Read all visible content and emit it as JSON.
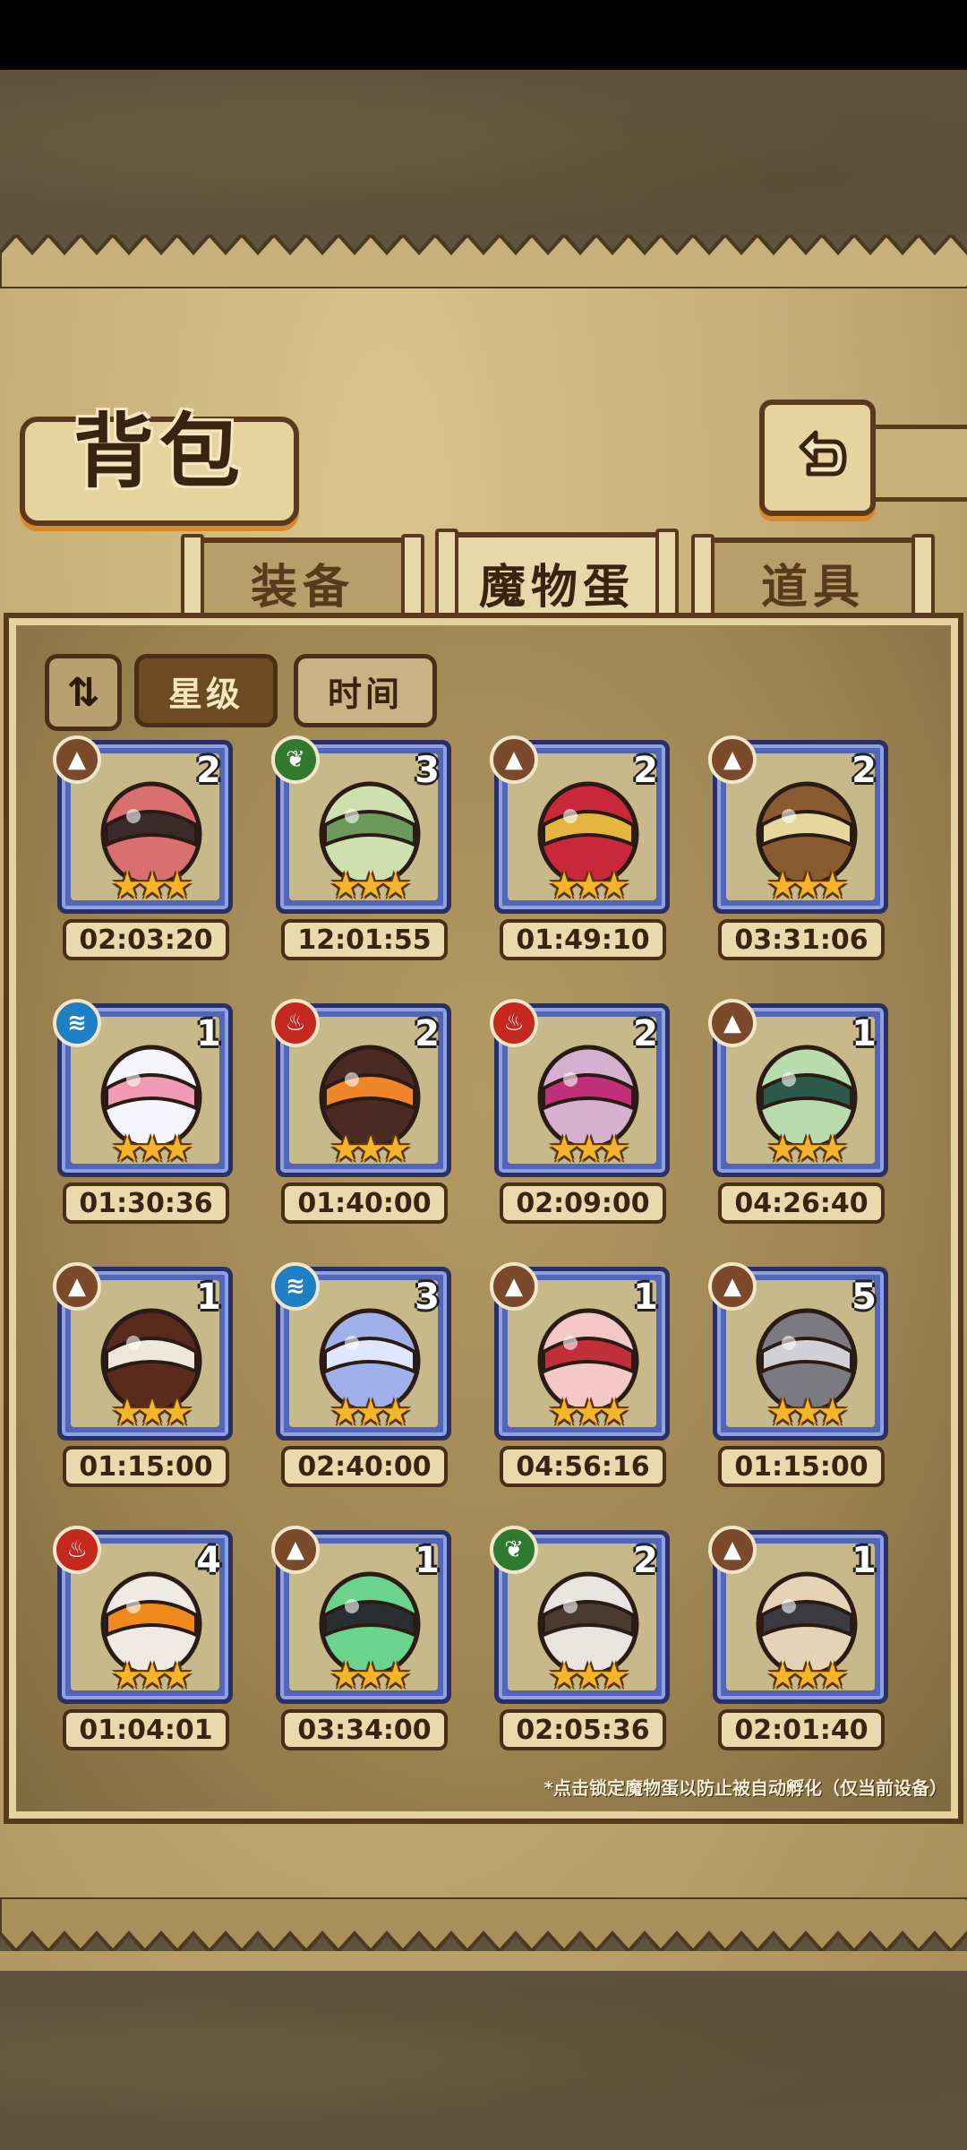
{
  "screen": {
    "title": "背包",
    "back_icon": "back-arrow-icon"
  },
  "tabs": [
    {
      "label": "装备",
      "active": false
    },
    {
      "label": "魔物蛋",
      "active": true
    },
    {
      "label": "道具",
      "active": false
    }
  ],
  "sort": {
    "toggle_icon": "sort-order-icon",
    "toggle_label": "⇅",
    "by_star_label": "星级",
    "by_time_label": "时间",
    "selected": "星级"
  },
  "elements_legend": {
    "earth": "#7a4a2a",
    "wood": "#2f7a2f",
    "water": "#1f7fc4",
    "fire": "#c4281f"
  },
  "eggs": [
    {
      "element": "earth",
      "count": "2",
      "stars": "★★★",
      "timer": "02:03:20",
      "art": "pink-cat-egg"
    },
    {
      "element": "wood",
      "count": "3",
      "stars": "★★★",
      "timer": "12:01:55",
      "art": "green-leaf-egg"
    },
    {
      "element": "earth",
      "count": "2",
      "stars": "★★★",
      "timer": "01:49:10",
      "art": "red-helmet-egg"
    },
    {
      "element": "earth",
      "count": "2",
      "stars": "★★★",
      "timer": "03:31:06",
      "art": "bear-fruit-egg"
    },
    {
      "element": "water",
      "count": "1",
      "stars": "★★★",
      "timer": "01:30:36",
      "art": "white-ribbon-egg"
    },
    {
      "element": "fire",
      "count": "2",
      "stars": "★★★",
      "timer": "01:40:00",
      "art": "flame-spike-egg"
    },
    {
      "element": "fire",
      "count": "2",
      "stars": "★★★",
      "timer": "02:09:00",
      "art": "mushroom-egg"
    },
    {
      "element": "earth",
      "count": "1",
      "stars": "★★★",
      "timer": "04:26:40",
      "art": "green-cloak-egg"
    },
    {
      "element": "earth",
      "count": "1",
      "stars": "★★★",
      "timer": "01:15:00",
      "art": "chocolate-egg"
    },
    {
      "element": "water",
      "count": "3",
      "stars": "★★★",
      "timer": "02:40:00",
      "art": "crystal-egg"
    },
    {
      "element": "earth",
      "count": "1",
      "stars": "★★★",
      "timer": "04:56:16",
      "art": "bow-egg"
    },
    {
      "element": "earth",
      "count": "5",
      "stars": "★★★",
      "timer": "01:15:00",
      "art": "cleaver-egg"
    },
    {
      "element": "fire",
      "count": "4",
      "stars": "★★★",
      "timer": "01:04:01",
      "art": "fire-tail-egg"
    },
    {
      "element": "earth",
      "count": "1",
      "stars": "★★★",
      "timer": "03:34:00",
      "art": "slime-egg"
    },
    {
      "element": "wood",
      "count": "2",
      "stars": "★★★",
      "timer": "02:05:36",
      "art": "spiked-egg"
    },
    {
      "element": "earth",
      "count": "1",
      "stars": "★★★",
      "timer": "02:01:40",
      "art": "furry-egg"
    }
  ],
  "hint": "*点击锁定魔物蛋以防止被自动孵化（仅当前设备）"
}
